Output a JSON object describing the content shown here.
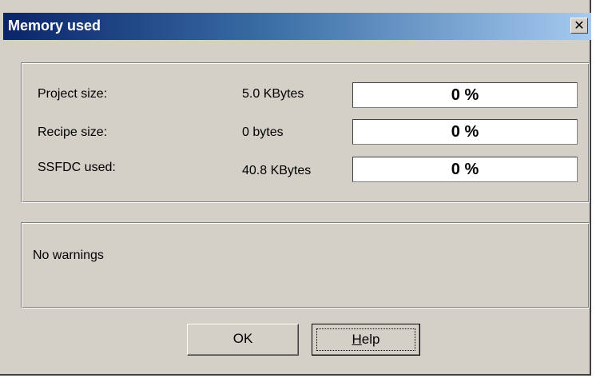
{
  "window": {
    "title": "Memory used",
    "close_glyph": "✕"
  },
  "memory": {
    "rows": [
      {
        "label": "Project size:",
        "value": "5.0 KBytes",
        "percent_text": "0 %",
        "percent": 0
      },
      {
        "label": "Recipe size:",
        "value": "0 bytes",
        "percent_text": "0 %",
        "percent": 0
      },
      {
        "label": "SSFDC used:",
        "value": "40.8 KBytes",
        "percent_text": "0 %",
        "percent": 0
      }
    ]
  },
  "warnings": {
    "text": "No warnings"
  },
  "buttons": {
    "ok_label": "OK",
    "help_label_first": "H",
    "help_label_rest": "elp"
  },
  "colors": {
    "title_start": "#0a246a",
    "title_end": "#a6caf0",
    "dialog_bg": "#d4d0c8",
    "progress_fill": "#0a246a"
  },
  "icons": {
    "close": "close-icon"
  }
}
